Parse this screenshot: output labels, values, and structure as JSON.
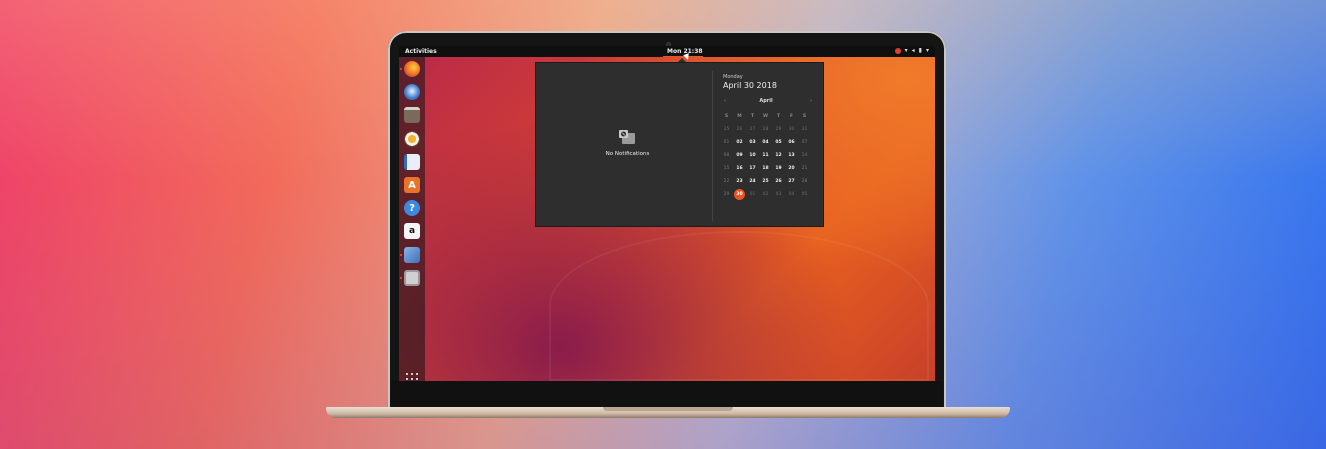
{
  "topbar": {
    "activities": "Activities",
    "clock": "Mon 21:38",
    "tray_icons": [
      "network-icon",
      "volume-icon",
      "battery-icon",
      "chevron-down-icon"
    ]
  },
  "dock": {
    "items": [
      "firefox-icon",
      "thunderbird-icon",
      "files-icon",
      "rhythmbox-icon",
      "writer-icon",
      "software-icon",
      "help-icon",
      "amazon-icon",
      "preferences-icon",
      "calculator-icon"
    ],
    "apps_grid": "show-applications-icon"
  },
  "notifications": {
    "empty_text": "No Notifications"
  },
  "calendar": {
    "weekday": "Monday",
    "date": "April 30 2018",
    "month": "April",
    "prev": "‹",
    "next": "›",
    "day_headers": [
      "S",
      "M",
      "T",
      "W",
      "T",
      "F",
      "S"
    ],
    "weeks": [
      [
        "25",
        "26",
        "27",
        "28",
        "29",
        "30",
        "31"
      ],
      [
        "01",
        "02",
        "03",
        "04",
        "05",
        "06",
        "07"
      ],
      [
        "08",
        "09",
        "10",
        "11",
        "12",
        "13",
        "14"
      ],
      [
        "15",
        "16",
        "17",
        "18",
        "19",
        "20",
        "21"
      ],
      [
        "22",
        "23",
        "24",
        "25",
        "26",
        "27",
        "28"
      ],
      [
        "29",
        "30",
        "01",
        "02",
        "03",
        "04",
        "05"
      ]
    ],
    "today": "30",
    "accent": "#e95420"
  }
}
